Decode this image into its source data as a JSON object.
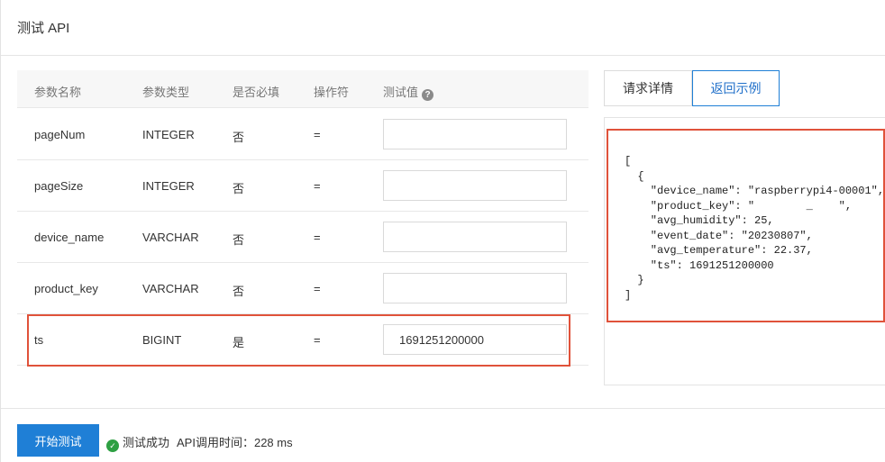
{
  "header": {
    "title": "测试 API"
  },
  "table": {
    "columns": [
      "参数名称",
      "参数类型",
      "是否必填",
      "操作符",
      "测试值"
    ],
    "rows": [
      {
        "name": "pageNum",
        "type": "INTEGER",
        "required": "否",
        "operator": "=",
        "value": ""
      },
      {
        "name": "pageSize",
        "type": "INTEGER",
        "required": "否",
        "operator": "=",
        "value": ""
      },
      {
        "name": "device_name",
        "type": "VARCHAR",
        "required": "否",
        "operator": "=",
        "value": ""
      },
      {
        "name": "product_key",
        "type": "VARCHAR",
        "required": "否",
        "operator": "=",
        "value": ""
      },
      {
        "name": "ts",
        "type": "BIGINT",
        "required": "是",
        "operator": "=",
        "value": "1691251200000"
      }
    ]
  },
  "tabs": [
    {
      "label": "请求详情",
      "active": false
    },
    {
      "label": "返回示例",
      "active": true
    }
  ],
  "response": {
    "code": "[\n  {\n    \"device_name\": \"raspberrypi4-00001\",\n    \"product_key\": \"        _    \",\n    \"avg_humidity\": 25,\n    \"event_date\": \"20230807\",\n    \"avg_temperature\": 22.37,\n    \"ts\": 1691251200000\n  }\n]"
  },
  "footer": {
    "start_label": "开始测试",
    "status_text": "测试成功",
    "time_text": "API调用时间：228 ms"
  },
  "colors": {
    "primary": "#1f7fd6",
    "highlight": "#e0523a",
    "success": "#2ea043"
  },
  "icons": {
    "help": "question-circle-icon",
    "success": "check-circle-icon"
  }
}
